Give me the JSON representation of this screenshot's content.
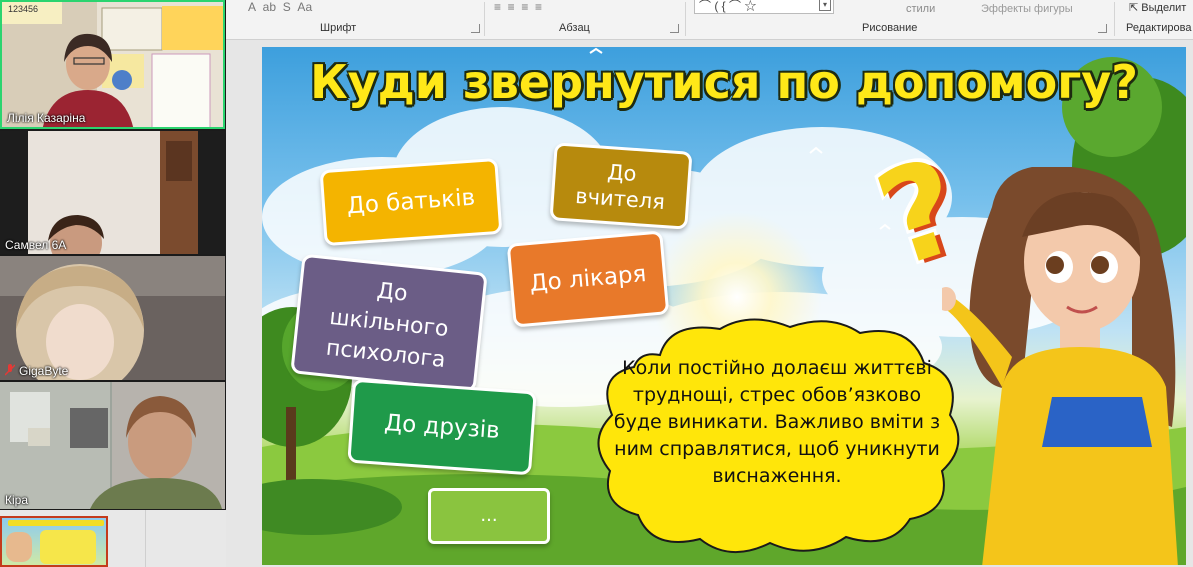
{
  "ribbon": {
    "groups": [
      {
        "label": "Шрифт"
      },
      {
        "label": "Абзац"
      },
      {
        "label": "Рисование"
      },
      {
        "label": "Редактирова"
      }
    ],
    "styles_label": "стили",
    "effects_label": "Эффекты фигуры",
    "select_label": "Выделит"
  },
  "participants": [
    {
      "name": "Лілія Казаріна",
      "active": true
    },
    {
      "name": "Самвел 6А",
      "active": false
    },
    {
      "name": "GigaByte",
      "muted": true
    },
    {
      "name": "Кіра",
      "active": false
    }
  ],
  "tile1_wall_text": "123456",
  "slide": {
    "title": "Куди звернутися по допомогу?",
    "cards": [
      {
        "label": "До батьків",
        "color": "#f4b400"
      },
      {
        "label": "До вчителя",
        "color": "#b78a0d"
      },
      {
        "label": "До лікаря",
        "color": "#e8792a"
      },
      {
        "label": "До шкільного психолога",
        "color": "#6b5d86"
      },
      {
        "label": "До друзів",
        "color": "#1f9a4a"
      },
      {
        "label": "...",
        "color": "#8ac43f"
      }
    ],
    "bubble_text": "Коли постійно долаєш життєві труднощі, стрес обов’язково буде виникати. Важливо вміти з ним справлятися, щоб уникнути виснаження.",
    "bubble_color": "#ffe60a"
  }
}
